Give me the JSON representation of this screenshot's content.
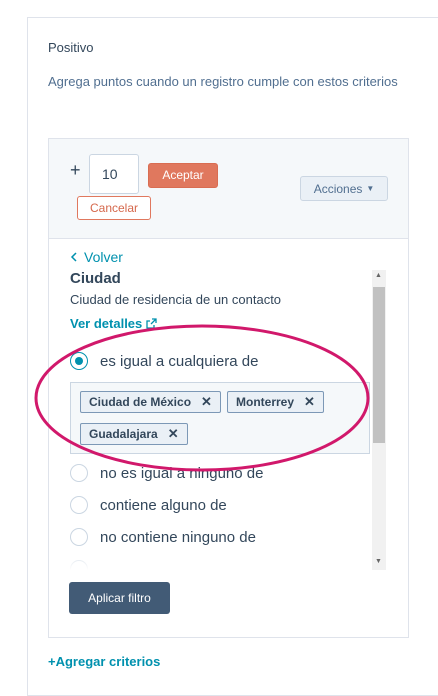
{
  "section": {
    "title": "Positivo",
    "description": "Agrega puntos cuando un registro cumple con estos criterios"
  },
  "scoring": {
    "plus": "+",
    "points_value": "10",
    "accept_label": "Aceptar",
    "cancel_label": "Cancelar",
    "actions_label": "Acciones"
  },
  "filter": {
    "back_label": "Volver",
    "property_name": "Ciudad",
    "property_description": "Ciudad de residencia de un contacto",
    "details_link": "Ver detalles",
    "options": [
      {
        "label": "es igual a cualquiera de",
        "checked": true
      },
      {
        "label": "no es igual a ninguno de",
        "checked": false
      },
      {
        "label": "contiene alguno de",
        "checked": false
      },
      {
        "label": "no contiene ninguno de",
        "checked": false
      }
    ],
    "selected_values": [
      "Ciudad de México",
      "Monterrey",
      "Guadalajara"
    ],
    "apply_label": "Aplicar filtro"
  },
  "add_criteria_label": "+Agregar criterios",
  "colors": {
    "accent": "#0091ae",
    "accept_button": "#e0785e",
    "apply_button": "#425b76",
    "highlight_ellipse": "#d1186b"
  },
  "icons": {
    "back": "chevron-left-icon",
    "external": "external-link-icon",
    "caret": "caret-down-icon",
    "tag_remove": "close-icon"
  }
}
